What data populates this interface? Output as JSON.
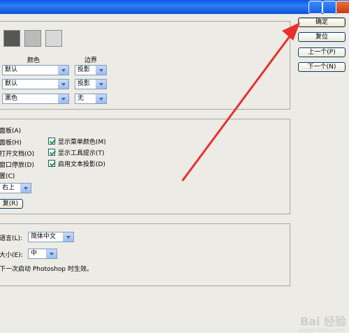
{
  "section1": {
    "col_color": "颜色",
    "col_border": "边界",
    "rows": [
      {
        "color": "默认",
        "border": "投影"
      },
      {
        "color": "默认",
        "border": "投影"
      },
      {
        "color": "黑色",
        "border": "无"
      }
    ],
    "swatch_colors": [
      "#555555",
      "#bbbbbb",
      "#d8d8d8"
    ]
  },
  "section2": {
    "left_items": [
      "面板(A)",
      "面板(H)",
      "打开文档(O)",
      "窗口停放(D)",
      "置(C)"
    ],
    "checks": [
      {
        "label": "显示菜单颜色(M)",
        "checked": true
      },
      {
        "label": "显示工具提示(T)",
        "checked": true
      },
      {
        "label": "启用文本投影(D)",
        "checked": true
      }
    ],
    "position_value": "右上",
    "reset_label": "复(R)"
  },
  "section3": {
    "language_label": "语言(L):",
    "language_value": "简体中文",
    "size_label": "大小(E):",
    "size_value": "中",
    "note": "下一次启动 Photoshop 时生效。"
  },
  "buttons": {
    "ok": "确定",
    "reset": "复位",
    "prev": "上一个(P)",
    "next": "下一个(N)"
  },
  "watermark": {
    "text": "Bai 经验",
    "url": "jingyan.baidu.com"
  },
  "colors": {
    "annotation_arrow": "#e8302c"
  }
}
